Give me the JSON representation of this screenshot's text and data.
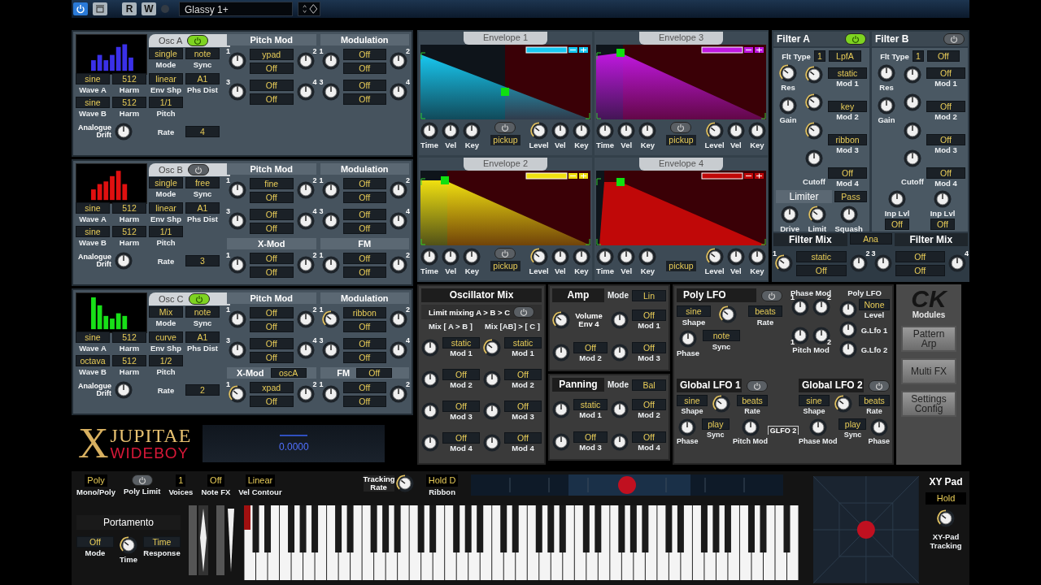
{
  "toolbar": {
    "power_on": true,
    "buttons": [
      "R",
      "W"
    ],
    "preset": "Glassy 1+"
  },
  "oscillators": [
    {
      "name": "Osc A",
      "on": true,
      "color": "#3a30e8",
      "fields": [
        {
          "value": "single",
          "label": "Mode"
        },
        {
          "value": "note",
          "label": "Sync"
        },
        {
          "value": "sine",
          "label": "Wave A"
        },
        {
          "value": "512",
          "label": "Harm"
        },
        {
          "value": "linear",
          "label": "Env Shp"
        },
        {
          "value": "A1",
          "label": "Phs Dist"
        },
        {
          "value": "sine",
          "label": "Wave B"
        },
        {
          "value": "512",
          "label": "Harm"
        },
        {
          "value": "1/1",
          "label": "Pitch"
        }
      ],
      "drift_label": "Analogue Drift",
      "rate_label": "Rate",
      "rate": "4",
      "sections": [
        {
          "title": "Pitch Mod",
          "slots": [
            {
              "numbers": [
                "1",
                "2"
              ],
              "values": [
                "ypad",
                "Off"
              ],
              "active": false
            },
            {
              "numbers": [
                "3",
                "4"
              ],
              "values": [
                "Off",
                "Off"
              ],
              "active": false
            }
          ]
        },
        {
          "title": "Modulation",
          "slots": [
            {
              "numbers": [
                "1",
                "2"
              ],
              "values": [
                "Off",
                "Off"
              ],
              "active": false
            },
            {
              "numbers": [
                "3",
                "4"
              ],
              "values": [
                "Off",
                "Off"
              ],
              "active": false
            }
          ]
        }
      ]
    },
    {
      "name": "Osc B",
      "on": false,
      "color": "#e01010",
      "fields": [
        {
          "value": "single",
          "label": "Mode"
        },
        {
          "value": "free",
          "label": "Sync"
        },
        {
          "value": "sine",
          "label": "Wave A"
        },
        {
          "value": "512",
          "label": "Harm"
        },
        {
          "value": "linear",
          "label": "Env Shp"
        },
        {
          "value": "A1",
          "label": "Phs Dist"
        },
        {
          "value": "sine",
          "label": "Wave B"
        },
        {
          "value": "512",
          "label": "Harm"
        },
        {
          "value": "1/1",
          "label": "Pitch"
        }
      ],
      "drift_label": "Analogue Drift",
      "rate_label": "Rate",
      "rate": "3",
      "sections": [
        {
          "title": "Pitch Mod",
          "slots": [
            {
              "numbers": [
                "1",
                "2"
              ],
              "values": [
                "fine",
                "Off"
              ],
              "active": false
            },
            {
              "numbers": [
                "3",
                "4"
              ],
              "values": [
                "Off",
                "Off"
              ],
              "active": false
            }
          ]
        },
        {
          "title": "Modulation",
          "slots": [
            {
              "numbers": [
                "1",
                "2"
              ],
              "values": [
                "Off",
                "Off"
              ],
              "active": false
            },
            {
              "numbers": [
                "3",
                "4"
              ],
              "values": [
                "Off",
                "Off"
              ],
              "active": false
            }
          ]
        },
        {
          "title": "X-Mod",
          "slots": [
            {
              "numbers": [
                "1",
                "2"
              ],
              "values": [
                "Off",
                "Off"
              ],
              "active": false
            }
          ]
        },
        {
          "title": "FM",
          "slots": [
            {
              "numbers": [
                "1",
                "2"
              ],
              "values": [
                "Off",
                "Off"
              ],
              "active": false
            }
          ]
        }
      ]
    },
    {
      "name": "Osc C",
      "on": true,
      "color": "#18e018",
      "fields": [
        {
          "value": "Mix",
          "label": "Mode"
        },
        {
          "value": "note",
          "label": "Sync"
        },
        {
          "value": "sine",
          "label": "Wave A"
        },
        {
          "value": "512",
          "label": "Harm"
        },
        {
          "value": "curve",
          "label": "Env Shp"
        },
        {
          "value": "A1",
          "label": "Phs Dist"
        },
        {
          "value": "octava",
          "label": "Wave B"
        },
        {
          "value": "512",
          "label": "Harm"
        },
        {
          "value": "1/2",
          "label": "Pitch"
        }
      ],
      "drift_label": "Analogue Drift",
      "rate_label": "Rate",
      "rate": "2",
      "sections": [
        {
          "title": "Pitch Mod",
          "slots": [
            {
              "numbers": [
                "1",
                "2"
              ],
              "values": [
                "Off",
                "Off"
              ],
              "active": false
            },
            {
              "numbers": [
                "3",
                "4"
              ],
              "values": [
                "Off",
                "Off"
              ],
              "active": false
            }
          ]
        },
        {
          "title": "Modulation",
          "slots": [
            {
              "numbers": [
                "1",
                "2"
              ],
              "values": [
                "ribbon",
                "Off"
              ],
              "active": true
            },
            {
              "numbers": [
                "3",
                "4"
              ],
              "values": [
                "Off",
                "Off"
              ],
              "active": false
            }
          ]
        },
        {
          "title": "X-Mod",
          "value": "oscA",
          "slots": [
            {
              "numbers": [
                "1",
                "2"
              ],
              "values": [
                "xpad",
                "Off"
              ],
              "active": true
            }
          ]
        },
        {
          "title": "FM",
          "value": "Off",
          "slots": [
            {
              "numbers": [
                "1",
                "2"
              ],
              "values": [
                "Off",
                "Off"
              ],
              "active": false
            }
          ]
        }
      ]
    }
  ],
  "logo": {
    "mark": "X",
    "top": "JUPITAE",
    "bottom": "WIDEBOY"
  },
  "display": {
    "value": "0.0000"
  },
  "envelopes": [
    {
      "title": "Envelope 1",
      "color": "#18c8f0",
      "toggle": true,
      "pickup": "pickup",
      "labels": [
        "Time",
        "Vel",
        "Key",
        "Level",
        "Vel",
        "Key"
      ]
    },
    {
      "title": "Envelope 3",
      "color": "#c018e0",
      "toggle": true,
      "pickup": "pickup",
      "labels": [
        "Time",
        "Vel",
        "Key",
        "Level",
        "Vel",
        "Key"
      ]
    },
    {
      "title": "Envelope 2",
      "color": "#f0e010",
      "toggle": true,
      "pickup": "pickup",
      "labels": [
        "Time",
        "Vel",
        "Key",
        "Level",
        "Vel",
        "Key"
      ]
    },
    {
      "title": "Envelope 4",
      "color": "#c00808",
      "toggle": false,
      "pickup": "pickup",
      "labels": [
        "Time",
        "Vel",
        "Key",
        "Level",
        "Vel",
        "Key"
      ]
    }
  ],
  "filters": [
    {
      "title": "Filter A",
      "on": true,
      "type_label": "Flt Type",
      "type_number": "1",
      "type": "LpfA",
      "res_label": "Res",
      "gain_label": "Gain",
      "cutoff_label": "Cutoff",
      "mods": [
        {
          "value": "static",
          "label": "Mod 1",
          "active": true
        },
        {
          "value": "key",
          "label": "Mod 2",
          "active": true
        },
        {
          "value": "ribbon",
          "label": "Mod 3",
          "active": true
        },
        {
          "value": "Off",
          "label": "Mod 4",
          "active": false
        }
      ],
      "limiter": {
        "title": "Limiter",
        "value": "Pass",
        "knobs": [
          "Drive",
          "Limit",
          "Squash"
        ]
      }
    },
    {
      "title": "Filter B",
      "on": false,
      "type_label": "Flt Type",
      "type_number": "1",
      "type": "Off",
      "res_label": "Res",
      "gain_label": "Gain",
      "cutoff_label": "Cutoff",
      "mods": [
        {
          "value": "Off",
          "label": "Mod 1",
          "active": false
        },
        {
          "value": "Off",
          "label": "Mod 2",
          "active": false
        },
        {
          "value": "Off",
          "label": "Mod 3",
          "active": false
        },
        {
          "value": "Off",
          "label": "Mod 4",
          "active": false
        }
      ],
      "inputs": [
        {
          "label": "Inp Lvl",
          "value": "Off"
        },
        {
          "label": "Inp Lvl",
          "value": "Off"
        }
      ]
    }
  ],
  "filter_mix": {
    "titles": [
      "Filter Mix",
      "Filter Mix"
    ],
    "mode": "Ana",
    "slots": [
      {
        "numbers": [
          "1",
          "2"
        ],
        "values": [
          "static",
          "Off"
        ],
        "active": true
      },
      {
        "numbers": [
          "3",
          "4"
        ],
        "values": [
          "Off",
          "Off"
        ],
        "active": false
      }
    ]
  },
  "osc_mix": {
    "title": "Oscillator Mix",
    "limit": {
      "label": "Limit mixing A > B > C",
      "on": false
    },
    "columns": [
      {
        "title": "Mix [ A > B ]",
        "rows": [
          {
            "value": "static",
            "label": "Mod 1",
            "active": false
          },
          {
            "value": "Off",
            "label": "Mod 2",
            "active": false
          },
          {
            "value": "Off",
            "label": "Mod 3",
            "active": false
          },
          {
            "value": "Off",
            "label": "Mod 4",
            "active": false
          }
        ]
      },
      {
        "title": "Mix [AB] > [ C ]",
        "rows": [
          {
            "value": "static",
            "label": "Mod 1",
            "active": true
          },
          {
            "value": "Off",
            "label": "Mod 2",
            "active": false
          },
          {
            "value": "Off",
            "label": "Mod 3",
            "active": false
          },
          {
            "value": "Off",
            "label": "Mod 4",
            "active": false
          }
        ]
      }
    ]
  },
  "amp": {
    "title": "Amp",
    "mode_label": "Mode",
    "mode": "Lin",
    "volume_label": "Volume Env 4",
    "mods": [
      {
        "value": "Off",
        "label": "Mod 1"
      },
      {
        "value": "Off",
        "label": "Mod 2"
      },
      {
        "value": "Off",
        "label": "Mod 3"
      }
    ]
  },
  "panning": {
    "title": "Panning",
    "mode_label": "Mode",
    "mode": "Bal",
    "mods": [
      {
        "value": "static",
        "label": "Mod 1"
      },
      {
        "value": "Off",
        "label": "Mod 2"
      },
      {
        "value": "Off",
        "label": "Mod 3"
      },
      {
        "value": "Off",
        "label": "Mod 4"
      }
    ]
  },
  "poly_lfo": {
    "title": "Poly LFO",
    "on": false,
    "shape": {
      "value": "sine",
      "label": "Shape"
    },
    "rate": {
      "value": "beats",
      "label": "Rate"
    },
    "phase_label": "Phase",
    "sync": {
      "value": "note",
      "label": "Sync"
    },
    "phase_mod": {
      "label": "Phase Mod",
      "numbers": [
        "1",
        "2"
      ]
    },
    "pitch_mod": {
      "label": "Pitch Mod",
      "numbers": [
        "1",
        "2"
      ]
    },
    "outputs": [
      {
        "title": "Poly LFO",
        "value": "None",
        "label": "Level"
      },
      {
        "label": "G.Lfo 1"
      },
      {
        "label": "G.Lfo 2"
      }
    ]
  },
  "global_lfos": [
    {
      "title": "Global LFO 1",
      "on": false,
      "shape": {
        "value": "sine",
        "label": "Shape"
      },
      "rate": {
        "value": "beats",
        "label": "Rate"
      },
      "phase_label": "Phase",
      "sync": {
        "value": "play",
        "label": "Sync"
      },
      "mod_label": "Pitch Mod"
    },
    {
      "title": "Global LFO 2",
      "on": false,
      "shape": {
        "value": "sine",
        "label": "Shape"
      },
      "rate": {
        "value": "beats",
        "label": "Rate"
      },
      "phase_label": "Phase",
      "sync": {
        "value": "play",
        "label": "Sync"
      },
      "mod_label": "Phase Mod"
    }
  ],
  "glfo_bracket": "GLFO 2",
  "brand": {
    "mark": "CK",
    "name": "Modules"
  },
  "side_buttons": [
    "Pattern Arp",
    "Multi FX",
    "Settings Config"
  ],
  "performance": {
    "controls": [
      {
        "kind": "value",
        "value": "Poly",
        "label": "Mono/Poly"
      },
      {
        "kind": "toggle",
        "on": false,
        "label": "Poly Limit"
      },
      {
        "kind": "value",
        "value": "1",
        "label": "Voices"
      },
      {
        "kind": "value",
        "value": "Off",
        "label": "Note FX"
      },
      {
        "kind": "value",
        "value": "Linear",
        "label": "Vel Contour"
      }
    ],
    "tracking_label": "Tracking Rate",
    "ribbon": {
      "value": "Hold D",
      "label": "Ribbon"
    }
  },
  "portamento": {
    "title": "Portamento",
    "mode": {
      "value": "Off",
      "label": "Mode"
    },
    "time_label": "Time",
    "response": {
      "value": "Time",
      "label": "Response"
    }
  },
  "xy_pad": {
    "title": "XY Pad",
    "hold": "Hold",
    "tracking_label": "XY-Pad Tracking"
  }
}
